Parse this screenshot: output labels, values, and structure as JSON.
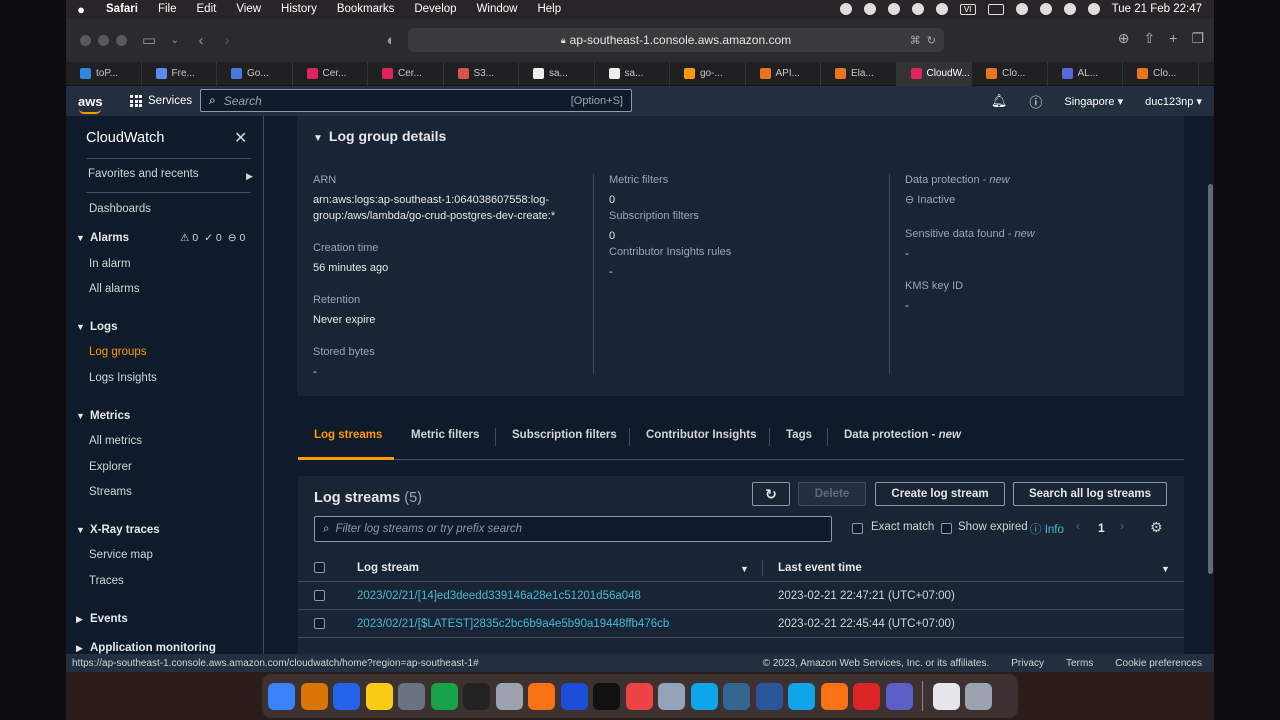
{
  "menubar": {
    "items": [
      "Safari",
      "File",
      "Edit",
      "View",
      "History",
      "Bookmarks",
      "Develop",
      "Window",
      "Help"
    ],
    "clock": "Tue 21 Feb  22:47",
    "vi_badge": "VI"
  },
  "browser": {
    "url": "ap-southeast-1.console.aws.amazon.com",
    "tabs": [
      {
        "label": "toP...",
        "color": "#2e86de"
      },
      {
        "label": "Fre...",
        "color": "#5b8def"
      },
      {
        "label": "Go...",
        "color": "#4a7bd8"
      },
      {
        "label": "Cer...",
        "color": "#e0245e"
      },
      {
        "label": "Cer...",
        "color": "#e0245e"
      },
      {
        "label": "S3...",
        "color": "#d9534f"
      },
      {
        "label": "sa...",
        "color": "#eeeeee"
      },
      {
        "label": "sa...",
        "color": "#eeeeee"
      },
      {
        "label": "go-...",
        "color": "#ff9900"
      },
      {
        "label": "API...",
        "color": "#e8751a"
      },
      {
        "label": "Ela...",
        "color": "#e8751a"
      },
      {
        "label": "CloudW...",
        "color": "#e0245e"
      },
      {
        "label": "Clo...",
        "color": "#e8751a"
      },
      {
        "label": "AL...",
        "color": "#5a67d8"
      },
      {
        "label": "Clo...",
        "color": "#e8751a"
      }
    ],
    "active_tab_index": 11
  },
  "aws_nav": {
    "logo": "aws",
    "services": "Services",
    "search_placeholder": "Search",
    "search_shortcut": "[Option+S]",
    "region": "Singapore",
    "user": "duc123np"
  },
  "sidebar": {
    "title": "CloudWatch",
    "favorites": "Favorites and recents",
    "dashboards": "Dashboards",
    "alarms": {
      "label": "Alarms",
      "counts": [
        "0",
        "0",
        "0"
      ],
      "items": [
        "In alarm",
        "All alarms"
      ]
    },
    "logs": {
      "label": "Logs",
      "items": [
        "Log groups",
        "Logs Insights"
      ],
      "active": "Log groups"
    },
    "metrics": {
      "label": "Metrics",
      "items": [
        "All metrics",
        "Explorer",
        "Streams"
      ]
    },
    "xray": {
      "label": "X-Ray traces",
      "items": [
        "Service map",
        "Traces"
      ]
    },
    "events": {
      "label": "Events"
    },
    "appmon": {
      "label": "Application monitoring"
    }
  },
  "details": {
    "title": "Log group details",
    "arn_label": "ARN",
    "arn_value_1": "arn:aws:logs:ap-southeast-1:064038607558:log-",
    "arn_value_2": "group:/aws/lambda/go-crud-postgres-dev-create:*",
    "creation_label": "Creation time",
    "creation_value": "56 minutes ago",
    "retention_label": "Retention",
    "retention_value": "Never expire",
    "stored_label": "Stored bytes",
    "stored_value": "-",
    "metric_filters_label": "Metric filters",
    "metric_filters_value": "0",
    "subscription_label": "Subscription filters",
    "subscription_value": "0",
    "contributor_label": "Contributor Insights rules",
    "contributor_value": "-",
    "data_protection_label": "Data protection - ",
    "data_protection_new": "new",
    "data_protection_value": "Inactive",
    "sensitive_label": "Sensitive data found - ",
    "sensitive_new": "new",
    "sensitive_value": "-",
    "kms_label": "KMS key ID",
    "kms_value": "-"
  },
  "content_tabs": {
    "log_streams": "Log streams",
    "metric_filters": "Metric filters",
    "subscription_filters": "Subscription filters",
    "contributor_insights": "Contributor Insights",
    "tags": "Tags",
    "data_protection": "Data protection - ",
    "data_protection_new": "new"
  },
  "log_streams": {
    "title": "Log streams",
    "count": "(5)",
    "delete": "Delete",
    "create": "Create log stream",
    "search_all": "Search all log streams",
    "filter_placeholder": "Filter log streams or try prefix search",
    "exact_match": "Exact match",
    "show_expired": "Show expired",
    "info": "Info",
    "page": "1",
    "col_stream": "Log stream",
    "col_time": "Last event time",
    "rows": [
      {
        "stream": "2023/02/21/[14]ed3deedd339146a28e1c51201d56a048",
        "time": "2023-02-21 22:47:21 (UTC+07:00)"
      },
      {
        "stream": "2023/02/21/[$LATEST]2835c2bc6b9a4e5b90a19448ffb476cb",
        "time": "2023-02-21 22:45:44 (UTC+07:00)"
      }
    ]
  },
  "statusbar": {
    "url": "https://ap-southeast-1.console.aws.amazon.com/cloudwatch/home?region=ap-southeast-1#",
    "copyright": "© 2023, Amazon Web Services, Inc. or its affiliates.",
    "privacy": "Privacy",
    "terms": "Terms",
    "cookies": "Cookie preferences"
  },
  "dock": {
    "apps": [
      {
        "name": "finder-icon",
        "color": "#3b82f6"
      },
      {
        "name": "launchpad-icon",
        "color": "#d97706"
      },
      {
        "name": "safari-icon",
        "color": "#2563eb"
      },
      {
        "name": "notes-icon",
        "color": "#facc15"
      },
      {
        "name": "system-preferences-icon",
        "color": "#6b7280"
      },
      {
        "name": "chrome-icon",
        "color": "#16a34a"
      },
      {
        "name": "activity-monitor-icon",
        "color": "#222222"
      },
      {
        "name": "textedit-icon",
        "color": "#9ca3af"
      },
      {
        "name": "postman-icon",
        "color": "#f97316"
      },
      {
        "name": "vscode-icon",
        "color": "#1d4ed8"
      },
      {
        "name": "terminal-icon",
        "color": "#111111"
      },
      {
        "name": "music-icon",
        "color": "#ef4444"
      },
      {
        "name": "tableplus-icon",
        "color": "#94a3b8"
      },
      {
        "name": "docker-icon",
        "color": "#0ea5e9"
      },
      {
        "name": "postgres-icon",
        "color": "#336791"
      },
      {
        "name": "word-icon",
        "color": "#2b579a"
      },
      {
        "name": "skype-icon",
        "color": "#0ea5e9"
      },
      {
        "name": "firefox-icon",
        "color": "#f97316"
      },
      {
        "name": "git-client-icon",
        "color": "#dc2626"
      },
      {
        "name": "teams-icon",
        "color": "#5b5fc7"
      }
    ],
    "extras": [
      {
        "name": "document-icon",
        "color": "#e5e7eb"
      },
      {
        "name": "trash-icon",
        "color": "#9ca3af"
      }
    ]
  }
}
